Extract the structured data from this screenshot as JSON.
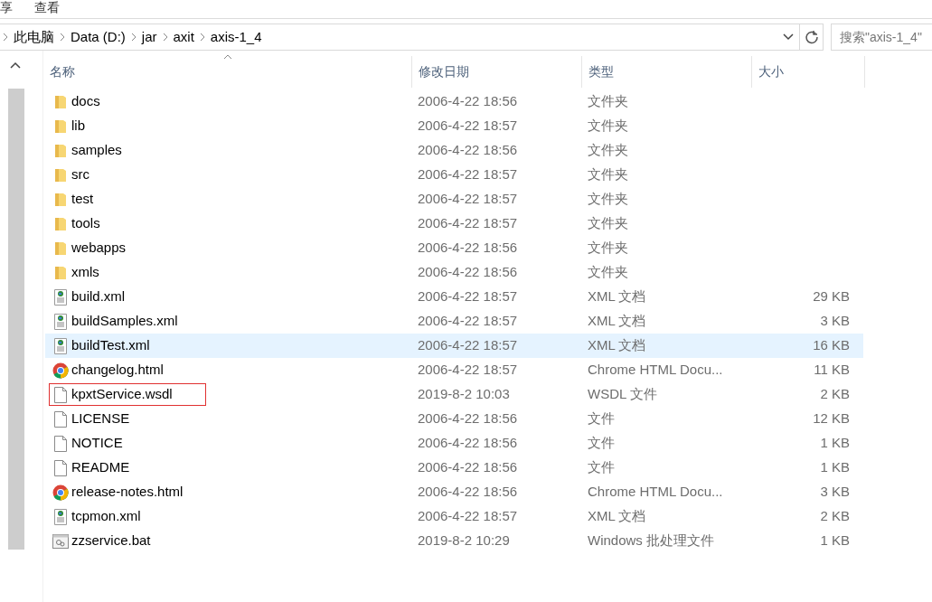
{
  "ribbon_tabs": [
    {
      "label": "享"
    },
    {
      "label": "查看"
    }
  ],
  "address_bar": {
    "crumbs": [
      "此电脑",
      "Data (D:)",
      "jar",
      "axit",
      "axis-1_4"
    ]
  },
  "search": {
    "placeholder": "搜索\"axis-1_4\""
  },
  "columns": [
    {
      "label": "名称",
      "sorted": true
    },
    {
      "label": "修改日期",
      "sorted": false
    },
    {
      "label": "类型",
      "sorted": false
    },
    {
      "label": "大小",
      "sorted": false
    }
  ],
  "files": [
    {
      "kind": "folder",
      "name": "docs",
      "date": "2006-4-22 18:56",
      "type": "文件夹",
      "selected": false,
      "highlighted": false
    },
    {
      "kind": "folder",
      "name": "lib",
      "date": "2006-4-22 18:57",
      "type": "文件夹",
      "selected": false,
      "highlighted": false
    },
    {
      "kind": "folder",
      "name": "samples",
      "date": "2006-4-22 18:56",
      "type": "文件夹",
      "selected": false,
      "highlighted": false
    },
    {
      "kind": "folder",
      "name": "src",
      "date": "2006-4-22 18:57",
      "type": "文件夹",
      "selected": false,
      "highlighted": false
    },
    {
      "kind": "folder",
      "name": "test",
      "date": "2006-4-22 18:57",
      "type": "文件夹",
      "selected": false,
      "highlighted": false
    },
    {
      "kind": "folder",
      "name": "tools",
      "date": "2006-4-22 18:57",
      "type": "文件夹",
      "selected": false,
      "highlighted": false
    },
    {
      "kind": "folder",
      "name": "webapps",
      "date": "2006-4-22 18:56",
      "type": "文件夹",
      "selected": false,
      "highlighted": false
    },
    {
      "kind": "folder",
      "name": "xmls",
      "date": "2006-4-22 18:56",
      "type": "文件夹",
      "selected": false,
      "highlighted": false
    },
    {
      "kind": "xml",
      "name": "build.xml",
      "date": "2006-4-22 18:57",
      "type": "XML 文档",
      "size": "29 KB",
      "selected": false,
      "highlighted": false
    },
    {
      "kind": "xml",
      "name": "buildSamples.xml",
      "date": "2006-4-22 18:57",
      "type": "XML 文档",
      "size": "3 KB",
      "selected": false,
      "highlighted": false
    },
    {
      "kind": "xml",
      "name": "buildTest.xml",
      "date": "2006-4-22 18:57",
      "type": "XML 文档",
      "size": "16 KB",
      "selected": true,
      "highlighted": false
    },
    {
      "kind": "chrome",
      "name": "changelog.html",
      "date": "2006-4-22 18:57",
      "type": "Chrome HTML Docu...",
      "size": "11 KB",
      "selected": false,
      "highlighted": false
    },
    {
      "kind": "file",
      "name": "kpxtService.wsdl",
      "date": "2019-8-2 10:03",
      "type": "WSDL 文件",
      "size": "2 KB",
      "selected": false,
      "highlighted": true
    },
    {
      "kind": "file",
      "name": "LICENSE",
      "date": "2006-4-22 18:56",
      "type": "文件",
      "size": "12 KB",
      "selected": false,
      "highlighted": false
    },
    {
      "kind": "file",
      "name": "NOTICE",
      "date": "2006-4-22 18:56",
      "type": "文件",
      "size": "1 KB",
      "selected": false,
      "highlighted": false
    },
    {
      "kind": "file",
      "name": "README",
      "date": "2006-4-22 18:56",
      "type": "文件",
      "size": "1 KB",
      "selected": false,
      "highlighted": false
    },
    {
      "kind": "chrome",
      "name": "release-notes.html",
      "date": "2006-4-22 18:56",
      "type": "Chrome HTML Docu...",
      "size": "3 KB",
      "selected": false,
      "highlighted": false
    },
    {
      "kind": "xml",
      "name": "tcpmon.xml",
      "date": "2006-4-22 18:57",
      "type": "XML 文档",
      "size": "2 KB",
      "selected": false,
      "highlighted": false
    },
    {
      "kind": "bat",
      "name": "zzservice.bat",
      "date": "2019-8-2 10:29",
      "type": "Windows 批处理文件",
      "size": "1 KB",
      "selected": false,
      "highlighted": false
    }
  ]
}
